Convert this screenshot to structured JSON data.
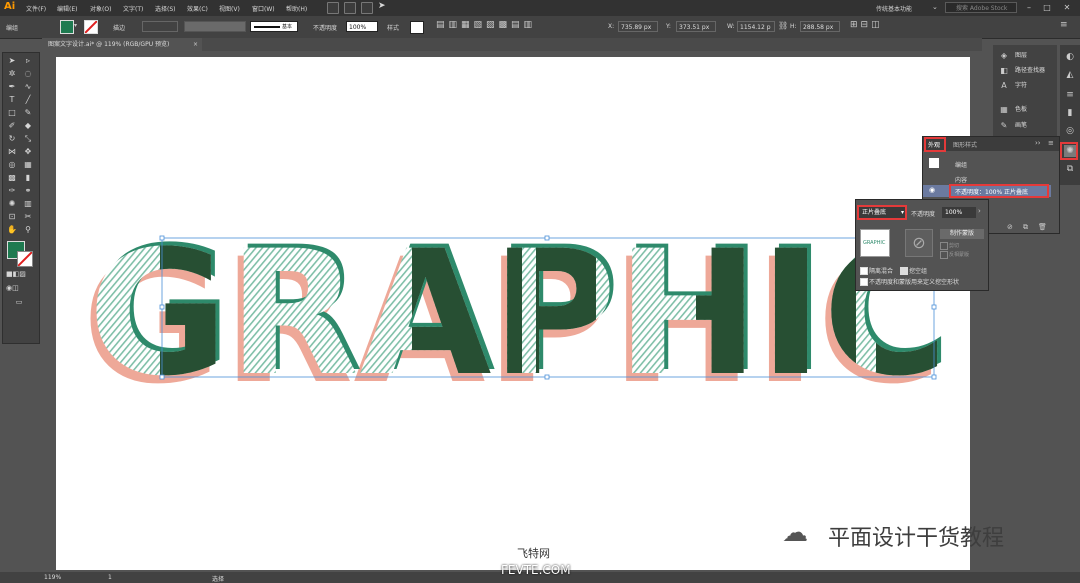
{
  "app": {
    "logo": "Ai"
  },
  "menu": [
    "文件(F)",
    "编辑(E)",
    "对象(O)",
    "文字(T)",
    "选择(S)",
    "效果(C)",
    "视图(V)",
    "窗口(W)",
    "帮助(H)"
  ],
  "workspace": "传统基本功能",
  "search_placeholder": "搜索 Adobe Stock",
  "control": {
    "mode": "编组",
    "stroke_label": "描边",
    "stroke_style": "基本",
    "opacity_label": "不透明度",
    "opacity_value": "100%",
    "style_label": "样式",
    "x": "735.89 px",
    "y": "373.51 px",
    "w": "1154.12 p",
    "h": "288.58 px"
  },
  "doc_tab": "图案文字设计.ai* @ 119% (RGB/GPU 预览)",
  "status": {
    "zoom": "119%",
    "page": "1",
    "tool": "选择"
  },
  "dock": [
    "图层",
    "路径查找器",
    "字符",
    "色板",
    "画笔"
  ],
  "appearance": {
    "tab1": "外观",
    "tab2": "图形样式",
    "group": "编组",
    "contents": "内容",
    "opacity_row": "不透明度：100% 正片叠底"
  },
  "transparency": {
    "blend": "正片叠底",
    "opacity_label": "不透明度",
    "opacity": "100%",
    "make_mask": "制作蒙版",
    "clip": "剪切",
    "invert": "反相蒙版",
    "isolate": "隔离混合",
    "knockout": "挖空组",
    "define_knockout": "不透明度和蒙版用来定义挖空形状"
  },
  "artwork": {
    "word": "GRAPHIC",
    "colors": {
      "dark": "#274f33",
      "teal": "#2e8a6b",
      "shadow": "#eea898",
      "stripe": "#7fbfa8"
    }
  },
  "watermark": {
    "text": "平面设计干货教程",
    "site_cn": "飞特网",
    "site_en": "FEVTE.COM"
  },
  "colors": {
    "accent": "#e43a3a",
    "fill_swatch": "#1e7a50"
  }
}
